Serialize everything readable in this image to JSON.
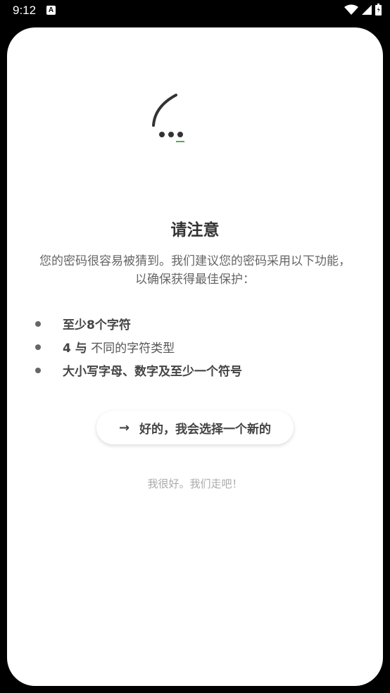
{
  "status_bar": {
    "time": "9:12",
    "notification_icon": "a-icon",
    "wifi_icon": "wifi-icon",
    "signal_icon": "signal-icon",
    "battery_icon": "battery-icon",
    "color": "#ffffff"
  },
  "dialog": {
    "logo_icon": "password-hint-logo-icon",
    "title": "请注意",
    "description": "您的密码很容易被猜到。我们建议您的密码采用以下功能，以确保获得最佳保护：",
    "requirements": [
      {
        "bold": "至少8个字符",
        "rest": ""
      },
      {
        "bold": "4 与",
        "rest": " 不同的字符类型"
      },
      {
        "bold": "大小写字母、数字及至少一个符号",
        "rest": ""
      }
    ],
    "primary_button": {
      "icon": "arrow-right-icon",
      "label": "好的，我会选择一个新的"
    },
    "secondary_link": "我很好。我们走吧！",
    "accent_color": "#4caf50"
  }
}
